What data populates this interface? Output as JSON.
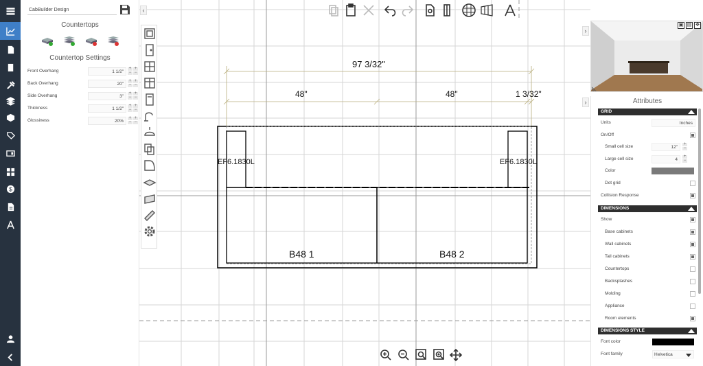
{
  "nav": {
    "icons": [
      "menu-icon",
      "chart-icon",
      "document-icon",
      "book-icon",
      "tools-icon",
      "layers-icon",
      "box-icon",
      "tag-icon",
      "display-icon",
      "grid-icon",
      "dollar-icon",
      "report-icon",
      "compass-icon",
      "user-icon",
      "back-arrow-icon"
    ]
  },
  "panel": {
    "design_name": "CabBuilder Design",
    "countertops_heading": "Countertops",
    "settings_heading": "Countertop Settings",
    "settings": [
      {
        "label": "Front Overhang",
        "value": "1 1/2\""
      },
      {
        "label": "Back Overhang",
        "value": "20\""
      },
      {
        "label": "Side Overhang",
        "value": "3\""
      },
      {
        "label": "Thickness",
        "value": "1 1/2\""
      },
      {
        "label": "Glossiness",
        "value": "20%"
      }
    ]
  },
  "canvas": {
    "dim_total": "97 3/32\"",
    "dim_seg1": "48\"",
    "dim_seg2": "48\"",
    "dim_seg3": "1 3/32\"",
    "label_left": "EF6.1830L",
    "label_right": "EF6.1830L",
    "cab1": "B48 1",
    "cab2": "B48 2"
  },
  "attributes": {
    "title": "Attributes",
    "grid_section": "GRID",
    "units_label": "Units",
    "units_value": "Inches",
    "onoff_label": "On/Off",
    "small_cell_label": "Small cell size",
    "small_cell_value": "12\"",
    "large_cell_label": "Large cell size",
    "large_cell_value": "4",
    "color_label": "Color",
    "grid_color": "#7a7a7a",
    "dotgrid_label": "Dot grid",
    "collision_label": "Collision Response",
    "dimensions_section": "DIMENSIONS",
    "show_label": "Show",
    "base_label": "Base cabinets",
    "wall_label": "Wall cabinets",
    "tall_label": "Tall cabinets",
    "countertops_label": "Countertops",
    "backsplashes_label": "Backsplashes",
    "molding_label": "Molding",
    "appliance_label": "Appliance",
    "room_label": "Room elements",
    "dimstyle_section": "DIMENSIONS STYLE",
    "fontcolor_label": "Font color",
    "font_color": "#000000",
    "fontfamily_label": "Font family",
    "fontfamily_value": "Helvetica"
  }
}
